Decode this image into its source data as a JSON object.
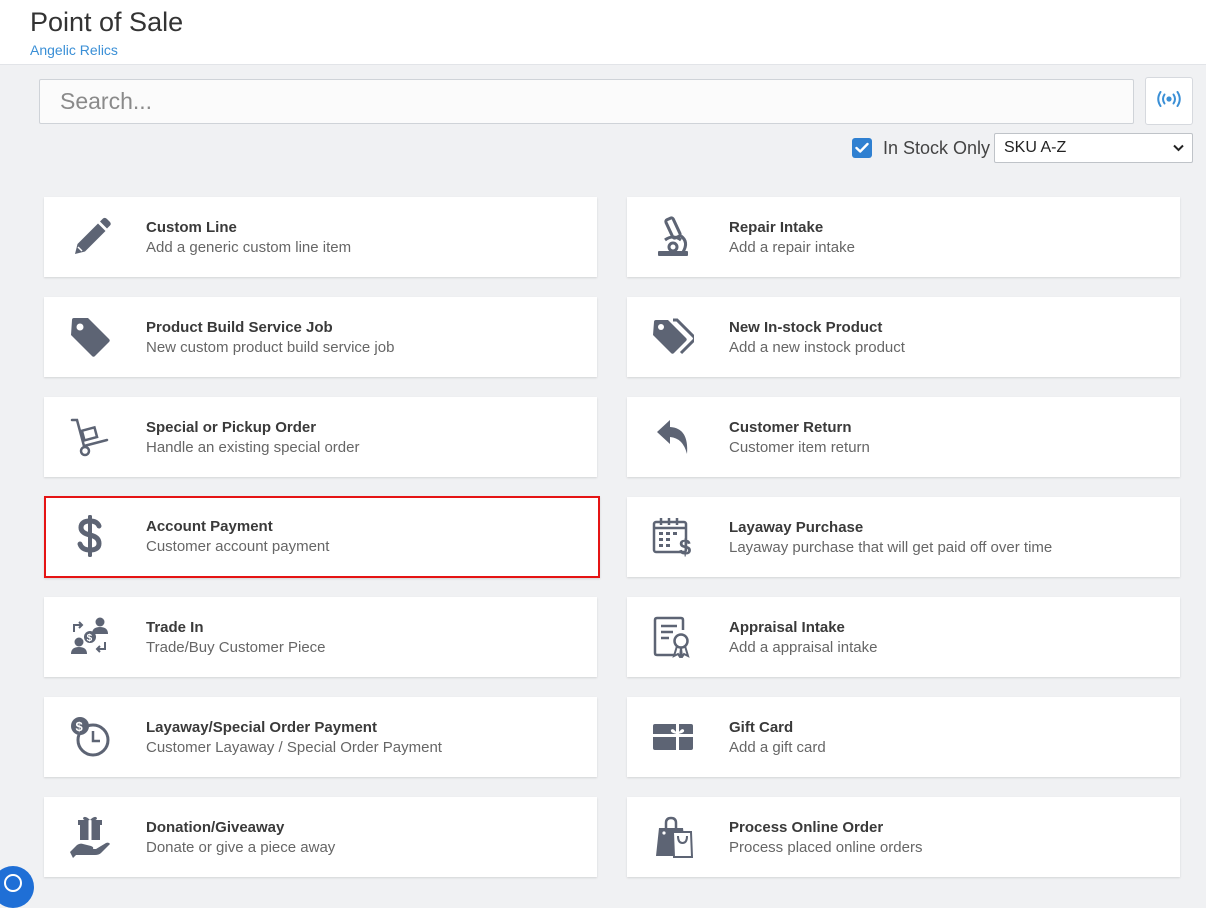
{
  "header": {
    "title": "Point of Sale",
    "subtitle": "Angelic Relics"
  },
  "search": {
    "placeholder": "Search..."
  },
  "filters": {
    "in_stock_label": "In Stock Only",
    "in_stock_checked": true,
    "sort_selected": "SKU A-Z"
  },
  "colors": {
    "accent": "#2f80d1",
    "icon": "#5d6474",
    "highlight": "#e51414"
  },
  "cards": [
    {
      "title": "Custom Line",
      "desc": "Add a generic custom line item",
      "icon": "pencil-icon"
    },
    {
      "title": "Repair Intake",
      "desc": "Add a repair intake",
      "icon": "microscope-icon"
    },
    {
      "title": "Product Build Service Job",
      "desc": "New custom product build service job",
      "icon": "tag-icon"
    },
    {
      "title": "New In-stock Product",
      "desc": "Add a new instock product",
      "icon": "tags-icon"
    },
    {
      "title": "Special or Pickup Order",
      "desc": "Handle an existing special order",
      "icon": "hand-truck-icon"
    },
    {
      "title": "Customer Return",
      "desc": "Customer item return",
      "icon": "reply-arrow-icon"
    },
    {
      "title": "Account Payment",
      "desc": "Customer account payment",
      "icon": "dollar-icon"
    },
    {
      "title": "Layaway Purchase",
      "desc": "Layaway purchase that will get paid off over time",
      "icon": "calendar-dollar-icon"
    },
    {
      "title": "Trade In",
      "desc": "Trade/Buy Customer Piece",
      "icon": "trade-icon"
    },
    {
      "title": "Appraisal Intake",
      "desc": "Add a appraisal intake",
      "icon": "certificate-icon"
    },
    {
      "title": "Layaway/Special Order Payment",
      "desc": "Customer Layaway / Special Order Payment",
      "icon": "clock-dollar-icon"
    },
    {
      "title": "Gift Card",
      "desc": "Add a gift card",
      "icon": "gift-card-icon"
    },
    {
      "title": "Donation/Giveaway",
      "desc": "Donate or give a piece away",
      "icon": "hand-gift-icon"
    },
    {
      "title": "Process Online Order",
      "desc": "Process placed online orders",
      "icon": "shopping-bag-icon"
    }
  ]
}
